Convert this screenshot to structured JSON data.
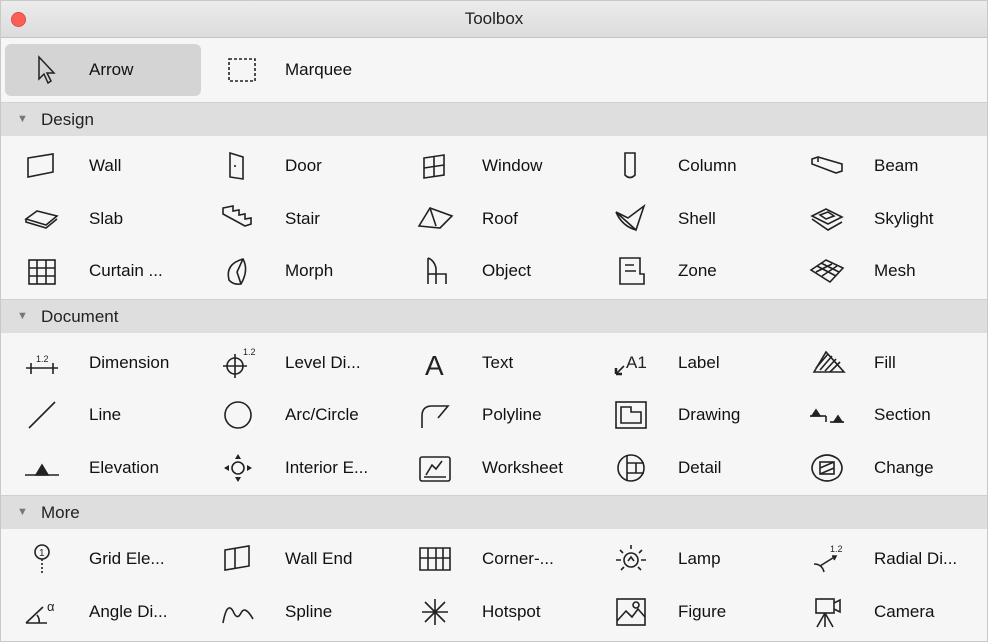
{
  "window": {
    "title": "Toolbox"
  },
  "top_tools": [
    {
      "label": "Arrow",
      "icon": "arrow-cursor-icon",
      "selected": true
    },
    {
      "label": "Marquee",
      "icon": "marquee-icon",
      "selected": false
    }
  ],
  "sections": [
    {
      "title": "Design",
      "rows": [
        [
          {
            "label": "Wall",
            "icon": "wall-icon"
          },
          {
            "label": "Door",
            "icon": "door-icon"
          },
          {
            "label": "Window",
            "icon": "window-icon"
          },
          {
            "label": "Column",
            "icon": "column-icon"
          },
          {
            "label": "Beam",
            "icon": "beam-icon"
          }
        ],
        [
          {
            "label": "Slab",
            "icon": "slab-icon"
          },
          {
            "label": "Stair",
            "icon": "stair-icon"
          },
          {
            "label": "Roof",
            "icon": "roof-icon"
          },
          {
            "label": "Shell",
            "icon": "shell-icon"
          },
          {
            "label": "Skylight",
            "icon": "skylight-icon"
          }
        ],
        [
          {
            "label": "Curtain ...",
            "icon": "curtain-wall-icon"
          },
          {
            "label": "Morph",
            "icon": "morph-icon"
          },
          {
            "label": "Object",
            "icon": "object-chair-icon"
          },
          {
            "label": "Zone",
            "icon": "zone-icon"
          },
          {
            "label": "Mesh",
            "icon": "mesh-icon"
          }
        ]
      ]
    },
    {
      "title": "Document",
      "rows": [
        [
          {
            "label": "Dimension",
            "icon": "dimension-icon"
          },
          {
            "label": "Level Di...",
            "icon": "level-dimension-icon"
          },
          {
            "label": "Text",
            "icon": "text-icon"
          },
          {
            "label": "Label",
            "icon": "label-icon"
          },
          {
            "label": "Fill",
            "icon": "fill-icon"
          }
        ],
        [
          {
            "label": "Line",
            "icon": "line-icon"
          },
          {
            "label": "Arc/Circle",
            "icon": "arc-circle-icon"
          },
          {
            "label": "Polyline",
            "icon": "polyline-icon"
          },
          {
            "label": "Drawing",
            "icon": "drawing-icon"
          },
          {
            "label": "Section",
            "icon": "section-icon"
          }
        ],
        [
          {
            "label": "Elevation",
            "icon": "elevation-icon"
          },
          {
            "label": "Interior E...",
            "icon": "interior-elevation-icon"
          },
          {
            "label": "Worksheet",
            "icon": "worksheet-icon"
          },
          {
            "label": "Detail",
            "icon": "detail-icon"
          },
          {
            "label": "Change",
            "icon": "change-icon"
          }
        ]
      ]
    },
    {
      "title": "More",
      "rows": [
        [
          {
            "label": "Grid Ele...",
            "icon": "grid-element-icon"
          },
          {
            "label": "Wall End",
            "icon": "wall-end-icon"
          },
          {
            "label": "Corner-...",
            "icon": "corner-window-icon"
          },
          {
            "label": "Lamp",
            "icon": "lamp-icon"
          },
          {
            "label": "Radial Di...",
            "icon": "radial-dimension-icon"
          }
        ],
        [
          {
            "label": "Angle Di...",
            "icon": "angle-dimension-icon"
          },
          {
            "label": "Spline",
            "icon": "spline-icon"
          },
          {
            "label": "Hotspot",
            "icon": "hotspot-icon"
          },
          {
            "label": "Figure",
            "icon": "figure-icon"
          },
          {
            "label": "Camera",
            "icon": "camera-icon"
          }
        ]
      ]
    }
  ],
  "icon_text": {
    "dimension_value": "1.2",
    "label_glyph": "A1",
    "text_glyph": "A",
    "angle_glyph": "α"
  }
}
